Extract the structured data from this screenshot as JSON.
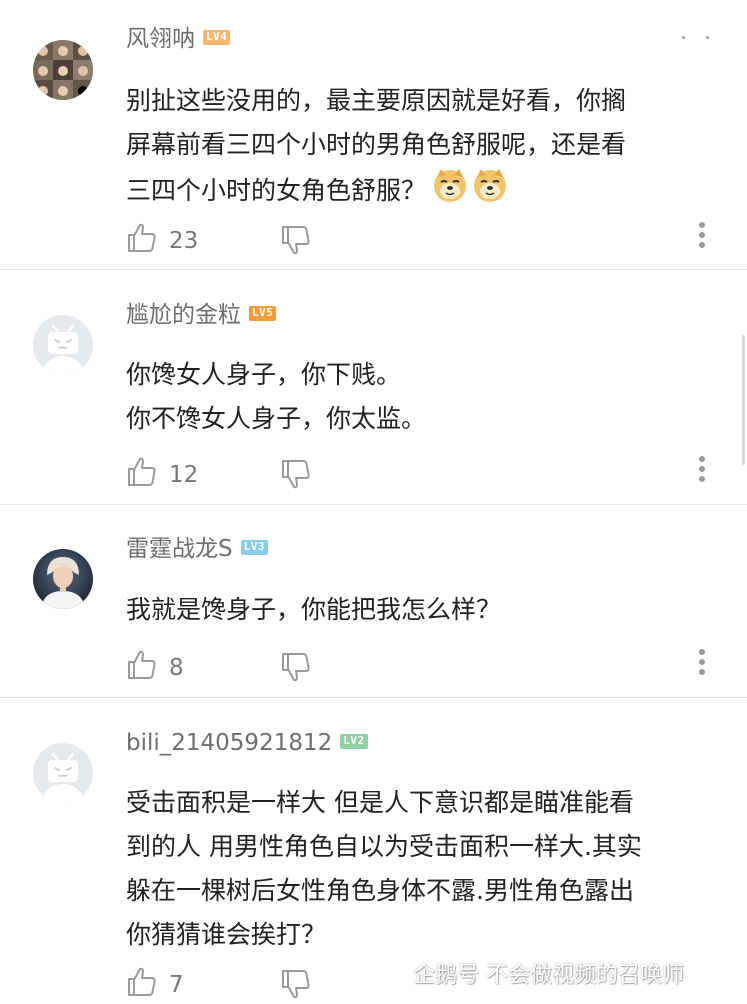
{
  "colors": {
    "lv2": "#8fd0a4",
    "lv3": "#8ccbe8",
    "lv4": "#f4b76d",
    "lv5": "#f39b3d",
    "icon_gray": "#999999"
  },
  "comments": [
    {
      "username": "风翎呐",
      "level": "LV4",
      "avatar": "photo-grid-avatar",
      "text": "别扯这些没用的，最主要原因就是好看，你搁\n屏幕前看三四个小时的男角色舒服呢，还是看\n三四个小时的女角色舒服？",
      "emoji": [
        "doge-emoji",
        "doge-emoji"
      ],
      "likes": "23"
    },
    {
      "username": "尴尬的金粒",
      "level": "LV5",
      "avatar": "bilibili-default-avatar",
      "text": "你馋女人身子，你下贱。\n你不馋女人身子，你太监。",
      "likes": "12"
    },
    {
      "username": "雷霆战龙S",
      "level": "LV3",
      "avatar": "person-photo-avatar",
      "text": "我就是馋身子，你能把我怎么样？",
      "likes": "8"
    },
    {
      "username": "bili_21405921812",
      "level": "LV2",
      "avatar": "bilibili-default-avatar",
      "text": "受击面积是一样大 但是人下意识都是瞄准能看\n到的人 用男性角色自以为受击面积一样大.其实\n躲在一棵树后女性角色身体不露.男性角色露出\n你猜猜谁会挨打？",
      "likes": "7"
    }
  ],
  "watermark": {
    "icon": "penguin-icon",
    "text": "企鹅号 不会做视频的召唤师"
  }
}
